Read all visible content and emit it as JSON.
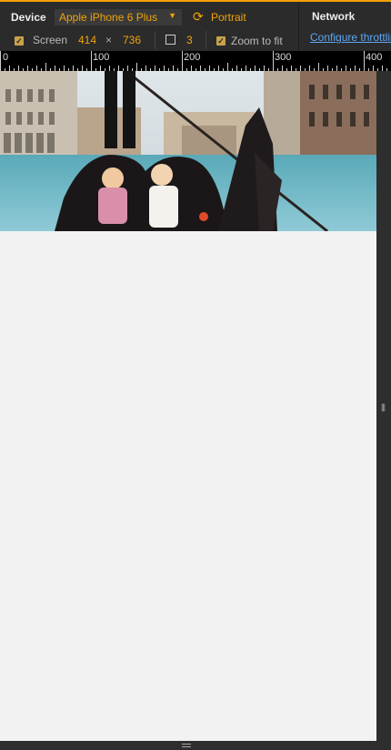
{
  "device_label": "Device",
  "device_value": "Apple iPhone 6 Plus",
  "orientation_label": "Portrait",
  "screen_label": "Screen",
  "screen_width": "414",
  "screen_times": "×",
  "screen_height": "736",
  "pixel_ratio": "3",
  "zoom_label": "Zoom to fit",
  "network_label": "Network",
  "network_link": "Configure throttling",
  "ruler_ticks": [
    "0",
    "100",
    "200",
    "300",
    "400"
  ],
  "icons": {
    "orientation": "rotate-icon",
    "pixel_ratio": "pixel-ratio-icon",
    "dropdown": "chevron-down-icon",
    "resize_right": "vertical-grip-icon",
    "resize_bottom": "horizontal-grip-icon"
  },
  "colors": {
    "accent": "#f0a30a",
    "link": "#5ea7f5"
  }
}
